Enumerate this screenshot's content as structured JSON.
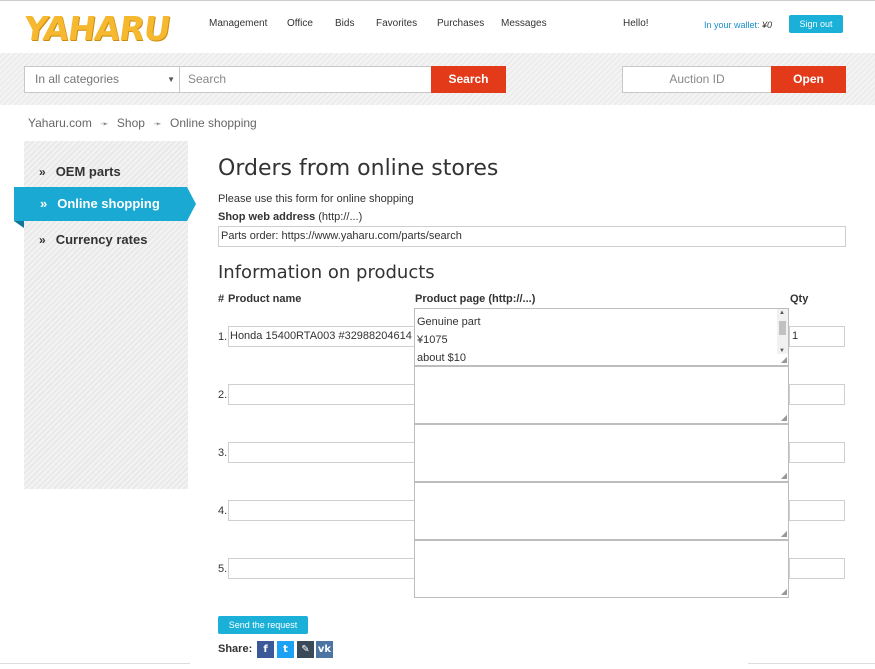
{
  "header": {
    "logo": "YAHARU",
    "nav": [
      "Management",
      "Office",
      "Bids",
      "Favorites",
      "Purchases",
      "Messages"
    ],
    "greeting": "Hello!",
    "wallet_label": "In your wallet:",
    "wallet_value": "¥0",
    "signout_label": "Sign out"
  },
  "search": {
    "category": "In all categories",
    "placeholder": "Search",
    "button": "Search",
    "auction_placeholder": "Auction ID",
    "open_button": "Open"
  },
  "breadcrumb": [
    "Yaharu.com",
    "Shop",
    "Online shopping"
  ],
  "sidebar": {
    "items": [
      "OEM parts",
      "Online shopping",
      "Currency rates"
    ],
    "active": "Online shopping"
  },
  "main": {
    "title": "Orders from online stores",
    "intro": "Please use this form for online shopping",
    "web_label_bold": "Shop web address",
    "web_label_hint": "(http://...)",
    "web_value": "Parts order: https://www.yaharu.com/parts/search",
    "products_title": "Information on products",
    "col_num": "#",
    "col_name": "Product name",
    "col_page": "Product page (http://...)",
    "col_qty": "Qty",
    "rows": [
      {
        "num": "1.",
        "name": "Honda 15400RTA003 #32988204614",
        "page_lines": [
          "Genuine part",
          "¥1075",
          "about $10"
        ],
        "qty": "1"
      },
      {
        "num": "2.",
        "name": "",
        "page_lines": [],
        "qty": ""
      },
      {
        "num": "3.",
        "name": "",
        "page_lines": [],
        "qty": ""
      },
      {
        "num": "4.",
        "name": "",
        "page_lines": [],
        "qty": ""
      },
      {
        "num": "5.",
        "name": "",
        "page_lines": [],
        "qty": ""
      }
    ],
    "send_button": "Send the request",
    "share_label": "Share:"
  },
  "colors": {
    "accent_blue": "#1aa9d3",
    "accent_red": "#e33b1a",
    "logo_yellow": "#f5b82e"
  }
}
